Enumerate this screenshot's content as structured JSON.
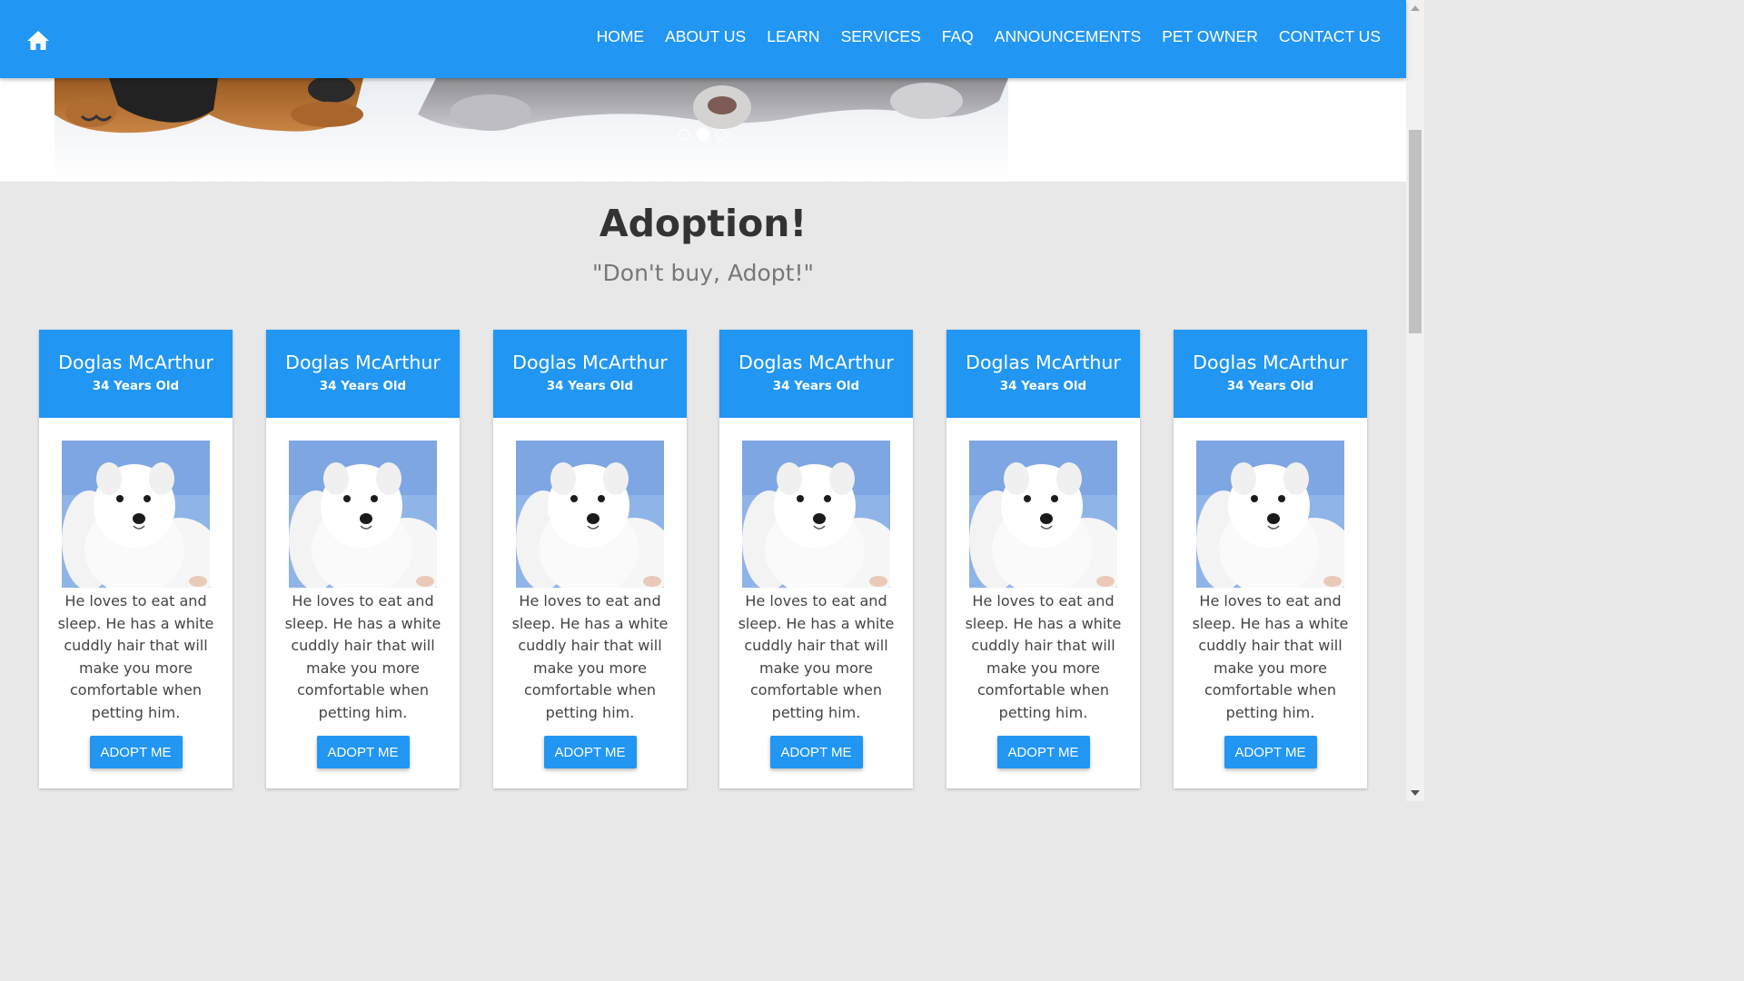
{
  "nav": {
    "home_icon": "home-icon",
    "items": [
      "HOME",
      "ABOUT US",
      "LEARN",
      "SERVICES",
      "FAQ",
      "ANNOUNCEMENTS",
      "PET OWNER",
      "CONTACT US"
    ]
  },
  "hero": {
    "slides": 3,
    "active_slide": 2
  },
  "adoption": {
    "title": "Adoption!",
    "subtitle": "\"Don't buy, Adopt!\"",
    "cards": [
      {
        "name": "Doglas McArthur",
        "age": "34 Years Old",
        "description": "He loves to eat and sleep. He has a white cuddly hair that will make you more comfortable when petting him.",
        "button": "ADOPT ME"
      },
      {
        "name": "Doglas McArthur",
        "age": "34 Years Old",
        "description": "He loves to eat and sleep. He has a white cuddly hair that will make you more comfortable when petting him.",
        "button": "ADOPT ME"
      },
      {
        "name": "Doglas McArthur",
        "age": "34 Years Old",
        "description": "He loves to eat and sleep. He has a white cuddly hair that will make you more comfortable when petting him.",
        "button": "ADOPT ME"
      },
      {
        "name": "Doglas McArthur",
        "age": "34 Years Old",
        "description": "He loves to eat and sleep. He has a white cuddly hair that will make you more comfortable when petting him.",
        "button": "ADOPT ME"
      },
      {
        "name": "Doglas McArthur",
        "age": "34 Years Old",
        "description": "He loves to eat and sleep. He has a white cuddly hair that will make you more comfortable when petting him.",
        "button": "ADOPT ME"
      },
      {
        "name": "Doglas McArthur",
        "age": "34 Years Old",
        "description": "He loves to eat and sleep. He has a white cuddly hair that will make you more comfortable when petting him.",
        "button": "ADOPT ME"
      }
    ]
  },
  "colors": {
    "primary": "#2196f3",
    "background": "#e8e8e8",
    "card": "#ffffff",
    "title": "#333333",
    "subtitle": "#777777"
  }
}
